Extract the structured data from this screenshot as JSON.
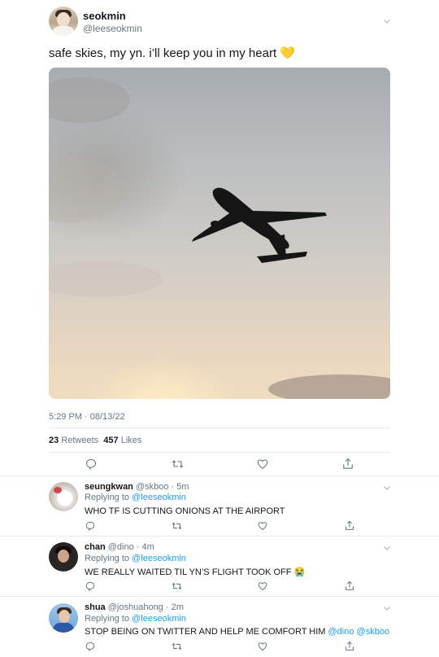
{
  "tweet": {
    "display_name": "seokmin",
    "handle": "@leeseokmin",
    "text": "safe skies, my yn. i’ll keep you in my heart 💛",
    "timestamp": "5:29 PM · 08/13/22",
    "retweets_count": "23",
    "retweets_label": "Retweets",
    "likes_count": "457",
    "likes_label": "Likes"
  },
  "actions": {
    "reply_icon": "reply-icon",
    "retweet_icon": "retweet-icon",
    "like_icon": "heart-icon",
    "share_icon": "share-icon"
  },
  "replies": [
    {
      "display_name": "seungkwan",
      "handle": "@skboo",
      "time": "5m",
      "replying_to_label": "Replying to",
      "replying_to": "@leeseokmin",
      "text": "WHO TF IS CUTTING ONIONS AT THE AIRPORT"
    },
    {
      "display_name": "chan",
      "handle": "@dino",
      "time": "4m",
      "replying_to_label": "Replying to",
      "replying_to": "@leeseokmin",
      "text": "WE REALLY WAITED TIL YN’S FLIGHT TOOK OFF 😭"
    },
    {
      "display_name": "shua",
      "handle": "@joshuahong",
      "time": "2m",
      "replying_to_label": "Replying to",
      "replying_to": "@leeseokmin",
      "text": "STOP BEING ON TWITTER AND HELP ME COMFORT HIM",
      "mentions": [
        "@dino",
        "@skboo"
      ]
    }
  ],
  "colors": {
    "link": "#1da1f2",
    "muted": "#657786",
    "divider": "#e6ecf0",
    "text": "#14171a"
  }
}
